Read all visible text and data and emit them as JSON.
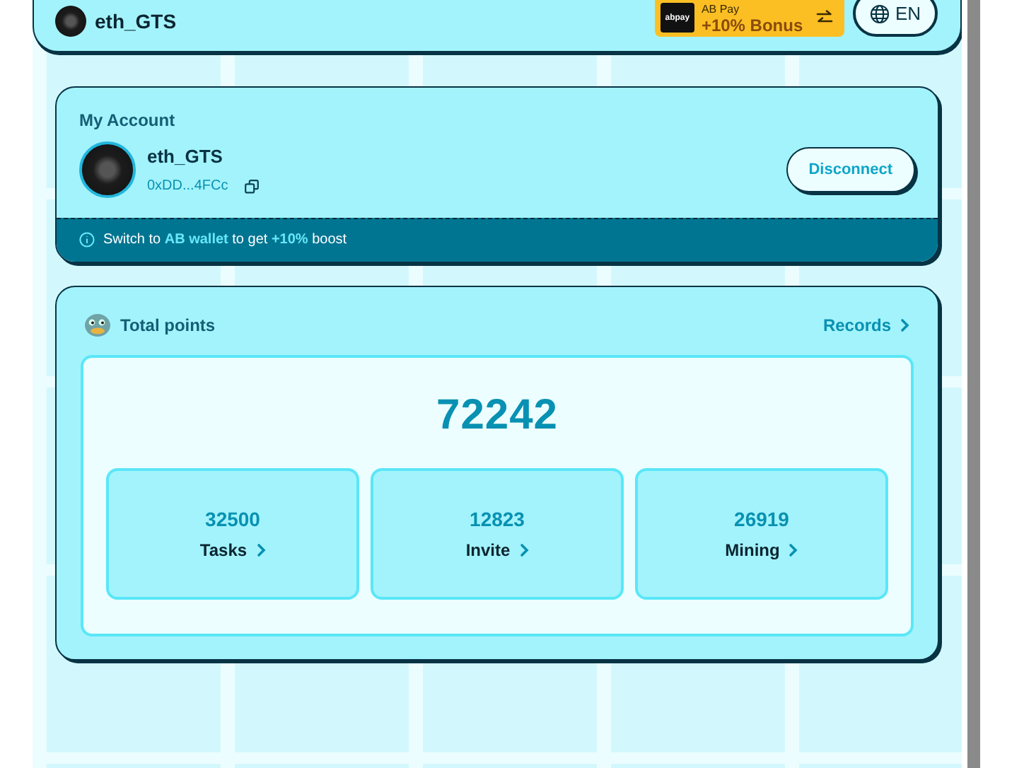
{
  "header": {
    "username": "eth_GTS",
    "promo": {
      "logo": "abpay",
      "title": "AB Pay",
      "bonus": "+10% Bonus"
    },
    "language": "EN"
  },
  "account": {
    "title": "My Account",
    "name": "eth_GTS",
    "address": "0xDD...4FCc",
    "disconnect": "Disconnect",
    "notice": "Switch to **AB wallet** to get **+10%** boost"
  },
  "points": {
    "title": "Total points",
    "records": "Records",
    "total": "72242",
    "stats": [
      {
        "value": "32500",
        "label": "Tasks"
      },
      {
        "value": "12823",
        "label": "Invite"
      },
      {
        "value": "26919",
        "label": "Mining"
      }
    ]
  }
}
